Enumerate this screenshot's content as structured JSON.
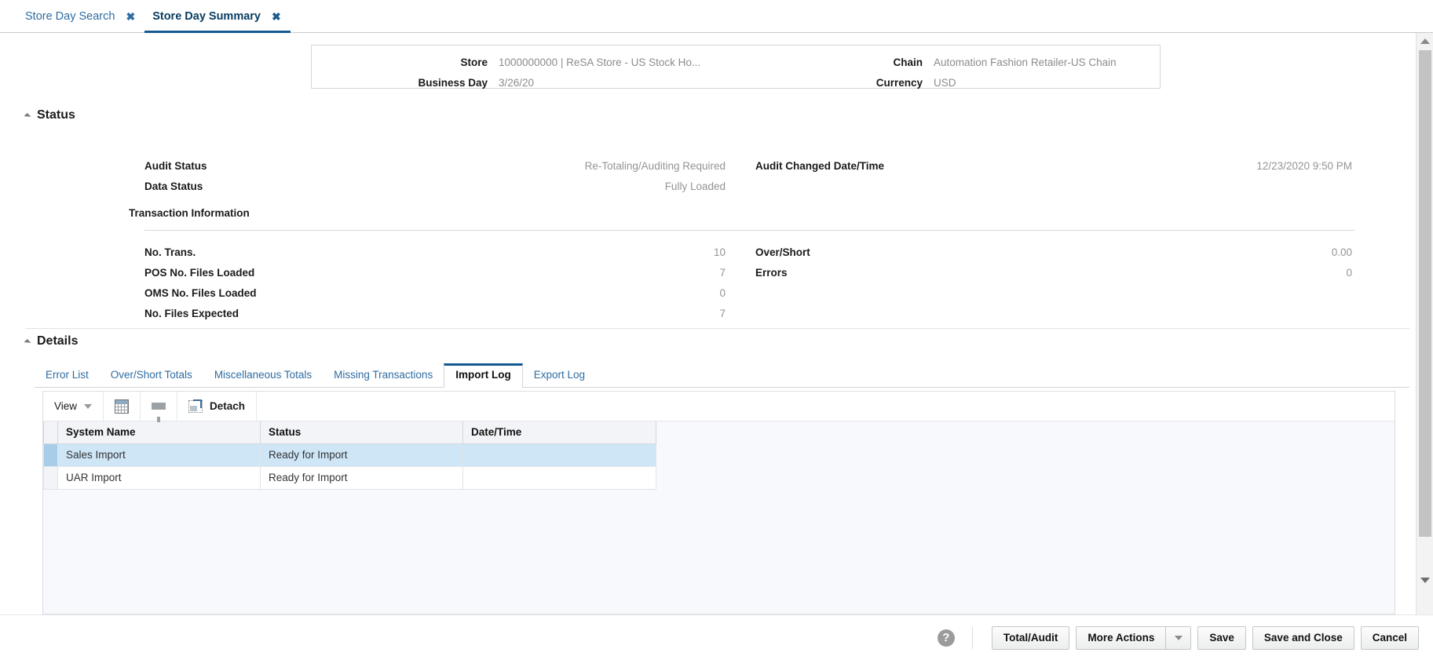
{
  "tabs": [
    {
      "label": "Store Day Search",
      "close": "✖",
      "active": false
    },
    {
      "label": "Store Day Summary",
      "close": "✖",
      "active": true
    }
  ],
  "header": {
    "store_label": "Store",
    "store_value": "1000000000 | ReSA Store - US Stock Ho...",
    "business_day_label": "Business Day",
    "business_day_value": "3/26/20",
    "chain_label": "Chain",
    "chain_value": "Automation Fashion Retailer-US Chain",
    "currency_label": "Currency",
    "currency_value": "USD"
  },
  "status_panel": {
    "title": "Status",
    "audit_status_label": "Audit Status",
    "audit_status_value": "Re-Totaling/Auditing Required",
    "data_status_label": "Data Status",
    "data_status_value": "Fully Loaded",
    "audit_changed_label": "Audit Changed Date/Time",
    "audit_changed_value": "12/23/2020 9:50 PM",
    "transaction_info_label": "Transaction Information",
    "no_trans_label": "No. Trans.",
    "no_trans_value": "10",
    "pos_files_label": "POS No. Files Loaded",
    "pos_files_value": "7",
    "oms_files_label": "OMS No. Files Loaded",
    "oms_files_value": "0",
    "files_expected_label": "No. Files Expected",
    "files_expected_value": "7",
    "over_short_label": "Over/Short",
    "over_short_value": "0.00",
    "errors_label": "Errors",
    "errors_value": "0"
  },
  "details_panel": {
    "title": "Details",
    "tabs": [
      {
        "label": "Error List",
        "active": false
      },
      {
        "label": "Over/Short Totals",
        "active": false
      },
      {
        "label": "Miscellaneous Totals",
        "active": false
      },
      {
        "label": "Missing Transactions",
        "active": false
      },
      {
        "label": "Import Log",
        "active": true
      },
      {
        "label": "Export Log",
        "active": false
      }
    ],
    "toolbar": {
      "view_label": "View",
      "export_icon": "spreadsheet-icon",
      "filter_icon": "funnel-icon",
      "detach_label": "Detach"
    },
    "table": {
      "columns": [
        "System Name",
        "Status",
        "Date/Time"
      ],
      "rows": [
        {
          "system_name": "Sales Import",
          "status": "Ready for Import",
          "datetime": "",
          "selected": true
        },
        {
          "system_name": "UAR Import",
          "status": "Ready for Import",
          "datetime": "",
          "selected": false
        }
      ]
    }
  },
  "footer": {
    "help_glyph": "?",
    "total_audit_label": "Total/Audit",
    "more_actions_label": "More Actions",
    "save_label": "Save",
    "save_close_label": "Save and Close",
    "cancel_label": "Cancel"
  },
  "colors": {
    "accent": "#15598f",
    "link": "#2e6ca3",
    "selected_row": "#cfe6f7",
    "value_text": "#949494"
  }
}
